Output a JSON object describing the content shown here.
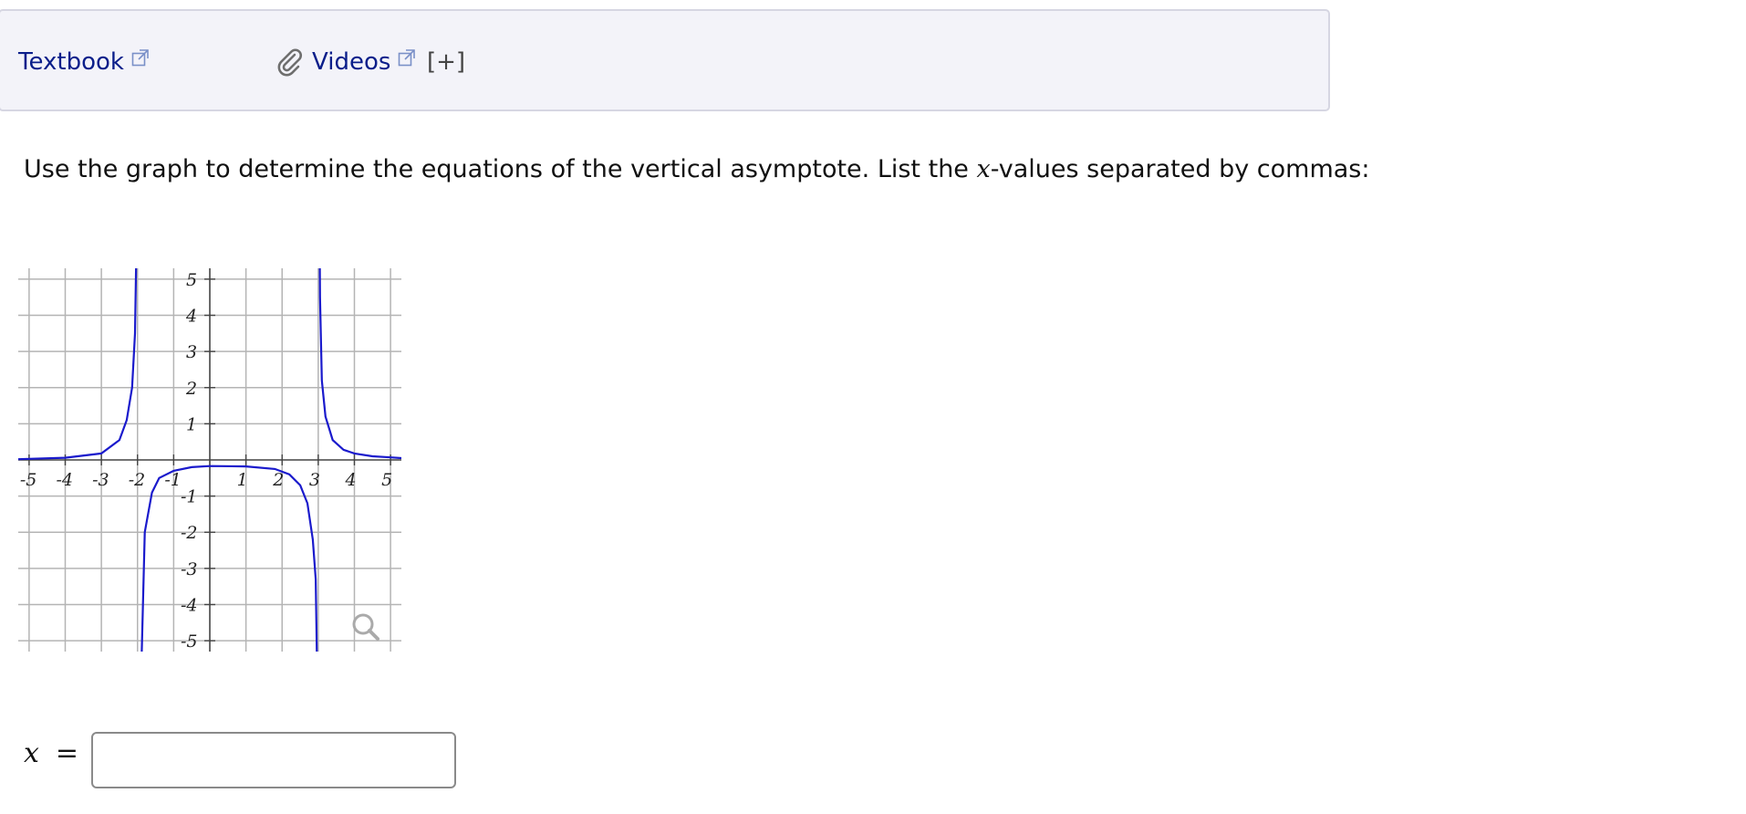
{
  "help": {
    "textbook_label": "Textbook",
    "videos_label": "Videos",
    "expand_label": "[+]"
  },
  "question": {
    "prompt_before": "Use the graph to determine the equations of the vertical asymptote. List the ",
    "prompt_var": "x",
    "prompt_after": "-values separated by commas:"
  },
  "answer": {
    "label_var": "x",
    "label_eq": "=",
    "value": "",
    "placeholder": ""
  },
  "colors": {
    "link": "#0a1e8a",
    "curve": "#1a1acc",
    "grid": "#b4b4b4",
    "help_bg": "#f3f3f9"
  },
  "icons": [
    "external-link-icon",
    "paperclip-icon",
    "magnifier-icon"
  ],
  "chart_data": {
    "type": "line",
    "xlim": [
      -5.3,
      5.3
    ],
    "ylim": [
      -5.3,
      5.3
    ],
    "grid": true,
    "x_ticks": [
      "-5",
      "-4",
      "-3",
      "-2",
      "-1",
      "1",
      "2",
      "3",
      "4",
      "5"
    ],
    "y_ticks": [
      "5",
      "4",
      "3",
      "2",
      "1",
      "-1",
      "-2",
      "-3",
      "-4",
      "-5"
    ],
    "vertical_asymptotes": [
      -2,
      3
    ],
    "series": [
      {
        "x": [
          -5.3,
          -5,
          -4,
          -3,
          -2.5,
          -2.3,
          -2.15,
          -2.07,
          -2.03,
          -2.02
        ],
        "y": [
          0.02,
          0.03,
          0.06,
          0.18,
          0.55,
          1.1,
          2.0,
          3.5,
          6.0,
          9.0
        ]
      },
      {
        "x": [
          -1.92,
          -1.9,
          -1.8,
          -1.6,
          -1.4,
          -1.0,
          -0.5,
          0,
          1,
          1.8,
          2.2,
          2.5,
          2.7,
          2.85,
          2.93,
          2.97
        ],
        "y": [
          -9.0,
          -6.0,
          -2.0,
          -0.9,
          -0.5,
          -0.3,
          -0.2,
          -0.17,
          -0.18,
          -0.25,
          -0.4,
          -0.7,
          -1.2,
          -2.2,
          -3.3,
          -6.0
        ]
      },
      {
        "x": [
          3.02,
          3.05,
          3.1,
          3.2,
          3.4,
          3.7,
          4,
          4.5,
          5,
          5.3
        ],
        "y": [
          9.0,
          4.5,
          2.2,
          1.2,
          0.55,
          0.28,
          0.18,
          0.1,
          0.07,
          0.05
        ]
      }
    ]
  }
}
